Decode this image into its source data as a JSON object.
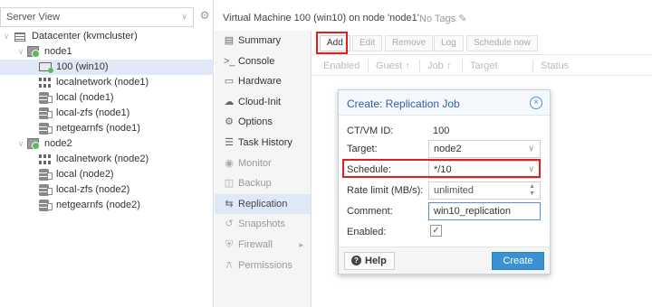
{
  "sidebar": {
    "view_label": "Server View",
    "tree": [
      {
        "label": "Datacenter (kvmcluster)",
        "icon": "datacenter-icon"
      },
      {
        "label": "node1",
        "icon": "node-online-icon"
      },
      {
        "label": "100 (win10)",
        "icon": "vm-running-icon"
      },
      {
        "label": "localnetwork (node1)",
        "icon": "sdn-zone-icon"
      },
      {
        "label": "local (node1)",
        "icon": "storage-icon"
      },
      {
        "label": "local-zfs (node1)",
        "icon": "storage-icon"
      },
      {
        "label": "netgearnfs (node1)",
        "icon": "storage-icon"
      },
      {
        "label": "node2",
        "icon": "node-online-icon"
      },
      {
        "label": "localnetwork (node2)",
        "icon": "sdn-zone-icon"
      },
      {
        "label": "local (node2)",
        "icon": "storage-icon"
      },
      {
        "label": "local-zfs (node2)",
        "icon": "storage-icon"
      },
      {
        "label": "netgearnfs (node2)",
        "icon": "storage-icon"
      }
    ]
  },
  "header": {
    "title": "Virtual Machine 100 (win10) on node 'node1'",
    "tags": "No Tags"
  },
  "nav": {
    "items": [
      {
        "label": "Summary",
        "icon": "book-icon"
      },
      {
        "label": "Console",
        "icon": "terminal-icon"
      },
      {
        "label": "Hardware",
        "icon": "monitor-icon"
      },
      {
        "label": "Cloud-Init",
        "icon": "cloud-icon"
      },
      {
        "label": "Options",
        "icon": "gear-icon"
      },
      {
        "label": "Task History",
        "icon": "list-icon"
      },
      {
        "label": "Monitor",
        "icon": "eye-icon"
      },
      {
        "label": "Backup",
        "icon": "floppy-icon"
      },
      {
        "label": "Replication",
        "icon": "retweet-icon"
      },
      {
        "label": "Snapshots",
        "icon": "history-icon"
      },
      {
        "label": "Firewall",
        "icon": "shield-icon"
      },
      {
        "label": "Permissions",
        "icon": "unlock-icon"
      }
    ]
  },
  "toolbar": {
    "add": "Add",
    "edit": "Edit",
    "remove": "Remove",
    "log": "Log",
    "schedule_now": "Schedule now"
  },
  "grid": {
    "columns": [
      "Enabled",
      "Guest",
      "Job",
      "Target",
      "Status"
    ]
  },
  "dialog": {
    "title": "Create: Replication Job",
    "ctvm_label": "CT/VM ID:",
    "ctvm_value": "100",
    "target_label": "Target:",
    "target_value": "node2",
    "schedule_label": "Schedule:",
    "schedule_value": "*/10",
    "rate_label": "Rate limit (MB/s):",
    "rate_value": "unlimited",
    "comment_label": "Comment:",
    "comment_value": "win10_replication",
    "enabled_label": "Enabled:",
    "enabled_checked": true,
    "help_label": "Help",
    "create_label": "Create"
  },
  "colors": {
    "accent": "#3892d4",
    "highlight_box": "#e02020",
    "selection": "#dfe8f6"
  }
}
